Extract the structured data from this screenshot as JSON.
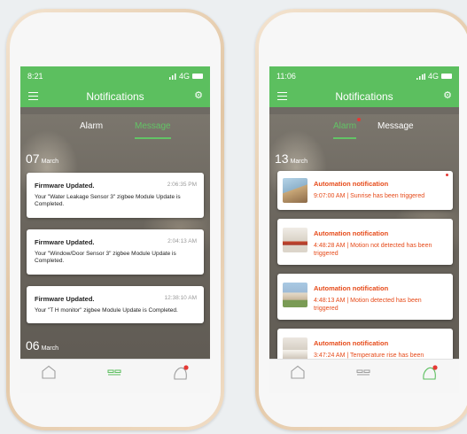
{
  "colors": {
    "header_green": "#5cbf5f",
    "tab_active_green": "#63c466",
    "alert_text": "#e64a19",
    "badge_red": "#e53935"
  },
  "left_phone": {
    "status": {
      "time": "8:21",
      "network": "4G"
    },
    "header": {
      "title": "Notifications",
      "menu_icon": "menu-icon",
      "settings_icon": "gear-icon"
    },
    "tabs": [
      {
        "label": "Alarm",
        "active": false
      },
      {
        "label": "Message",
        "active": true
      }
    ],
    "groups": [
      {
        "day": "07",
        "month": "March"
      },
      {
        "day": "06",
        "month": "March"
      }
    ],
    "messages": [
      {
        "title": "Firmware Updated.",
        "time": "2:06:35 PM",
        "body": "Your \"Water Leakage Sensor 3\" zigbee Module Update is Completed."
      },
      {
        "title": "Firmware Updated.",
        "time": "2:04:13 AM",
        "body": "Your \"Window/Door Sensor 3\" zigbee Module Update is Completed."
      },
      {
        "title": "Firmware Updated.",
        "time": "12:38:10 AM",
        "body": "Your \"T H monitor\" zigbee Module Update is Completed."
      }
    ],
    "bottom_nav": [
      "home-icon",
      "devices-icon",
      "alerts-icon"
    ]
  },
  "right_phone": {
    "status": {
      "time": "11:06",
      "network": "4G"
    },
    "header": {
      "title": "Notifications",
      "menu_icon": "menu-icon",
      "settings_icon": "gear-icon"
    },
    "tabs": [
      {
        "label": "Alarm",
        "active": true,
        "badge": true
      },
      {
        "label": "Message",
        "active": false
      }
    ],
    "group": {
      "day": "13",
      "month": "March"
    },
    "alarms": [
      {
        "title": "Automation notification",
        "detail": "9:07:00 AM | Sunrise has been triggered",
        "unread": true
      },
      {
        "title": "Automation notification",
        "detail": "4:48:28 AM | Motion not detected has been triggered"
      },
      {
        "title": "Automation notification",
        "detail": "4:48:13 AM | Motion detected has been triggered"
      },
      {
        "title": "Automation notification",
        "detail": "3:47:24 AM | Temperature rise has been"
      }
    ],
    "bottom_nav": [
      "home-icon",
      "devices-icon",
      "alerts-icon"
    ]
  }
}
